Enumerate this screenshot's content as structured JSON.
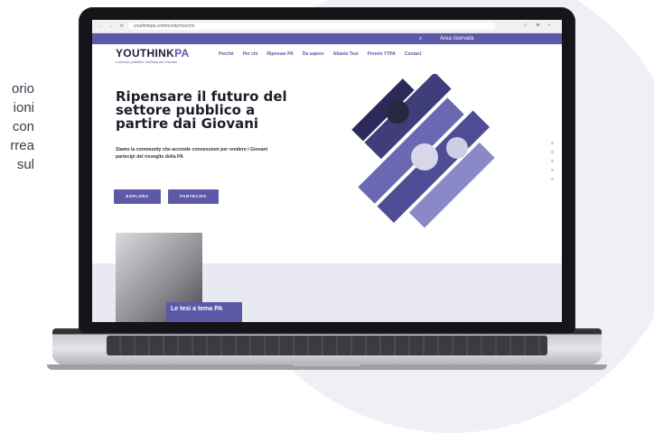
{
  "side_text": [
    "orio",
    "ioni",
    "con",
    "rrea",
    "sul"
  ],
  "browser": {
    "url": "youthinkpa.community/ricerchi",
    "nav_icons": "← → ⟳",
    "right_icons": "☆ ⊕ ◐"
  },
  "topbar": {
    "search_icon": "search-icon",
    "reserved_area": "Area riservata"
  },
  "header": {
    "logo_main": "YOUTHINK",
    "logo_accent": "PA",
    "tagline": "Il settore pubblico nell'idea dei Giovani",
    "menu": [
      "Perché",
      "Per chi",
      "Ripensar PA",
      "Da sapere",
      "Atlante Tesi",
      "Premio YTPA",
      "Contact"
    ]
  },
  "hero": {
    "title": "Ripensare il futuro del settore pubblico a partire dai Giovani",
    "subtitle": "Siamo la community che accende connessioni per rendere i Giovani partecipi del risveglio della PA",
    "btn_explore": "ESPLORA",
    "btn_participate": "PARTECIPA"
  },
  "tesi_card": "Le tesi a tema PA",
  "colors": {
    "brand": "#5c5aa6",
    "dark": "#1d1d2b"
  }
}
